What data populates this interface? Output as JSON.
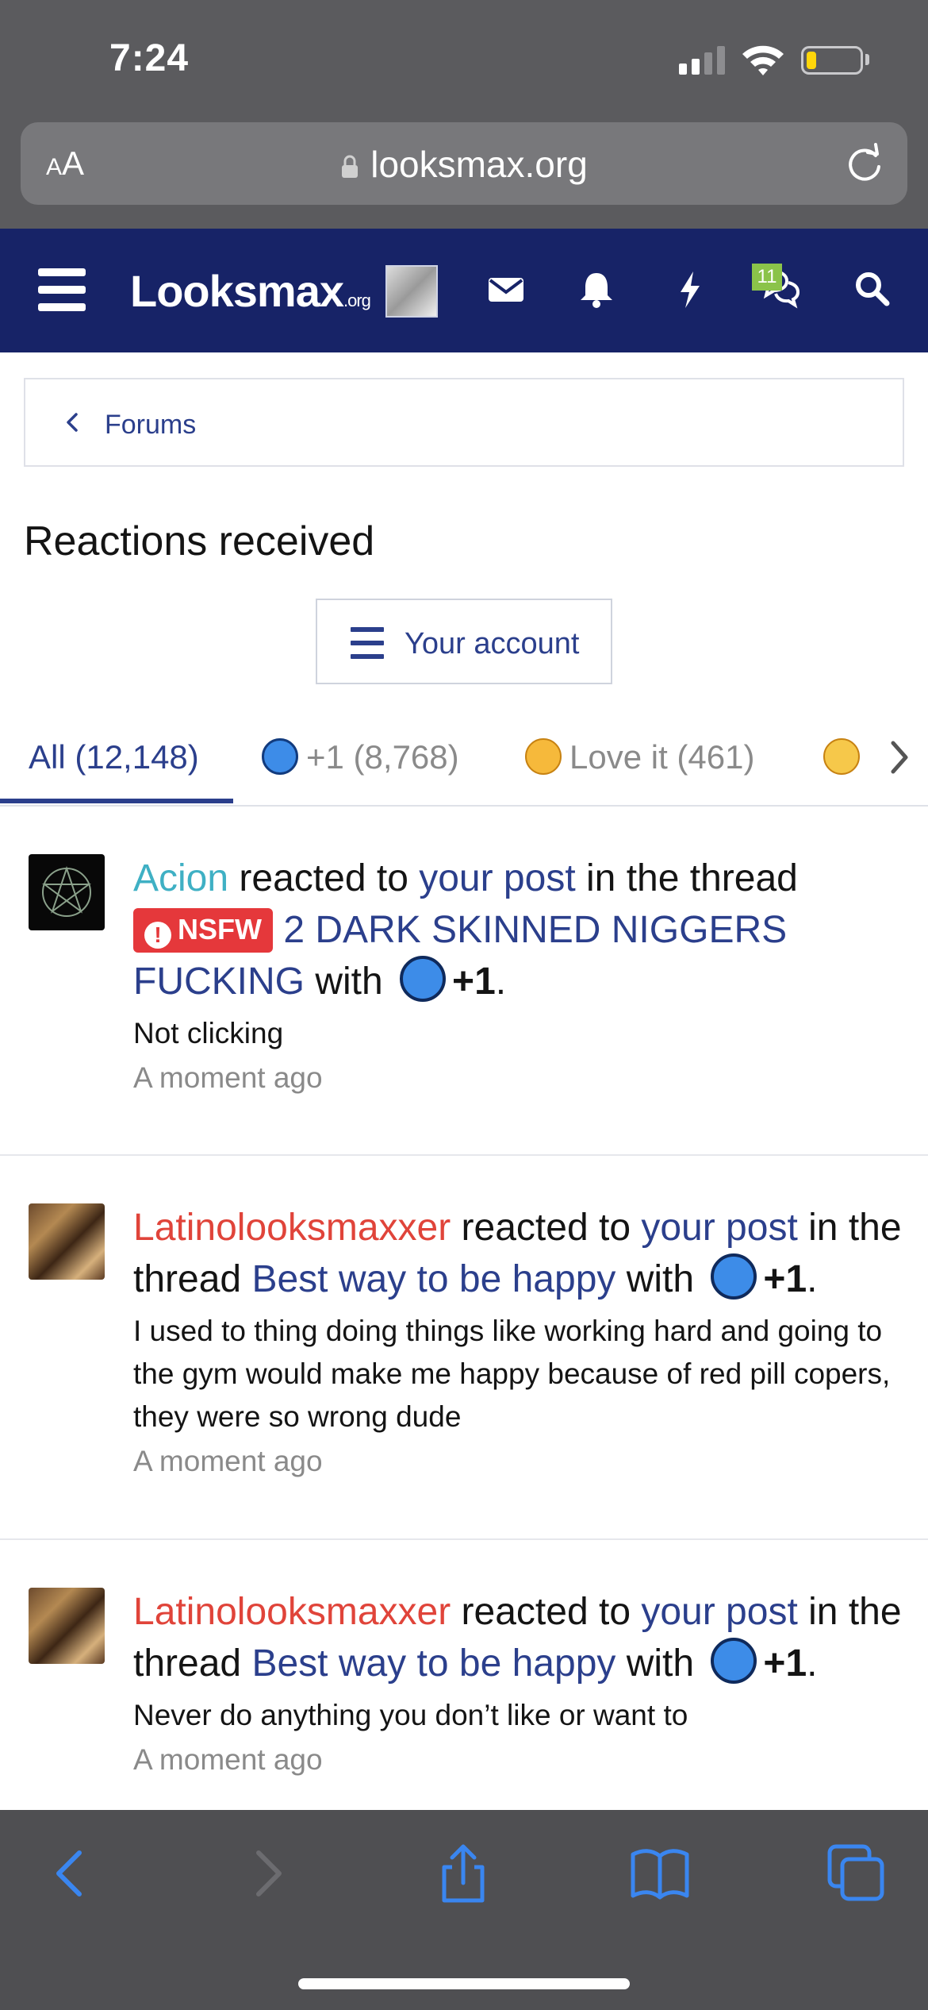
{
  "status_bar": {
    "time": "7:24"
  },
  "address_bar": {
    "aa_small": "A",
    "aa_large": "A",
    "url": "looksmax.org"
  },
  "header": {
    "logo": "Looksmax",
    "logo_suffix": ".org",
    "conversations_badge": "11"
  },
  "breadcrumb": {
    "label": "Forums"
  },
  "page": {
    "title": "Reactions received",
    "account_button": "Your account"
  },
  "tabs": [
    {
      "label": "All (12,148)"
    },
    {
      "label": "+1 (8,768)"
    },
    {
      "label": "Love it (461)"
    }
  ],
  "feed": [
    {
      "user": "Acion",
      "t1": " reacted to ",
      "post_link": "your post",
      "t2": " in the thread ",
      "prefix": "NSFW",
      "thread": "2 DARK SKINNED NIGGERS FUCKING",
      "t3": " with ",
      "reaction": "+1",
      "t4": ".",
      "snippet": "Not clicking",
      "time": "A moment ago"
    },
    {
      "user": "Latinolooksmaxxer",
      "t1": " reacted to ",
      "post_link": "your post",
      "t2": " in the thread ",
      "thread": "Best way to be happy",
      "t3": " with ",
      "reaction": "+1",
      "t4": ".",
      "snippet": "I used to thing doing things like working hard and going to the gym would make me happy because of red pill copers, they were so wrong dude",
      "time": "A moment ago"
    },
    {
      "user": "Latinolooksmaxxer",
      "t1": " reacted to ",
      "post_link": "your post",
      "t2": " in the thread ",
      "thread": "Best way to be happy",
      "t3": " with ",
      "reaction": "+1",
      "t4": ".",
      "snippet": "Never do anything you don’t like or want to",
      "time": "A moment ago"
    }
  ],
  "colors": {
    "header_bg": "#172367",
    "link": "#2b3f8c",
    "nsfw_red": "#e5383b",
    "user_teal": "#3fb0c4",
    "user_red": "#e0443a",
    "toolbar_icon": "#3a86f0"
  },
  "icons": {
    "status": [
      "signal-icon",
      "wifi-icon",
      "battery-icon"
    ],
    "header": [
      "menu-icon",
      "mail-icon",
      "bell-icon",
      "lightning-icon",
      "conversations-icon",
      "search-icon"
    ],
    "toolbar": [
      "back-icon",
      "forward-icon",
      "share-icon",
      "bookmarks-icon",
      "tabs-icon"
    ]
  }
}
